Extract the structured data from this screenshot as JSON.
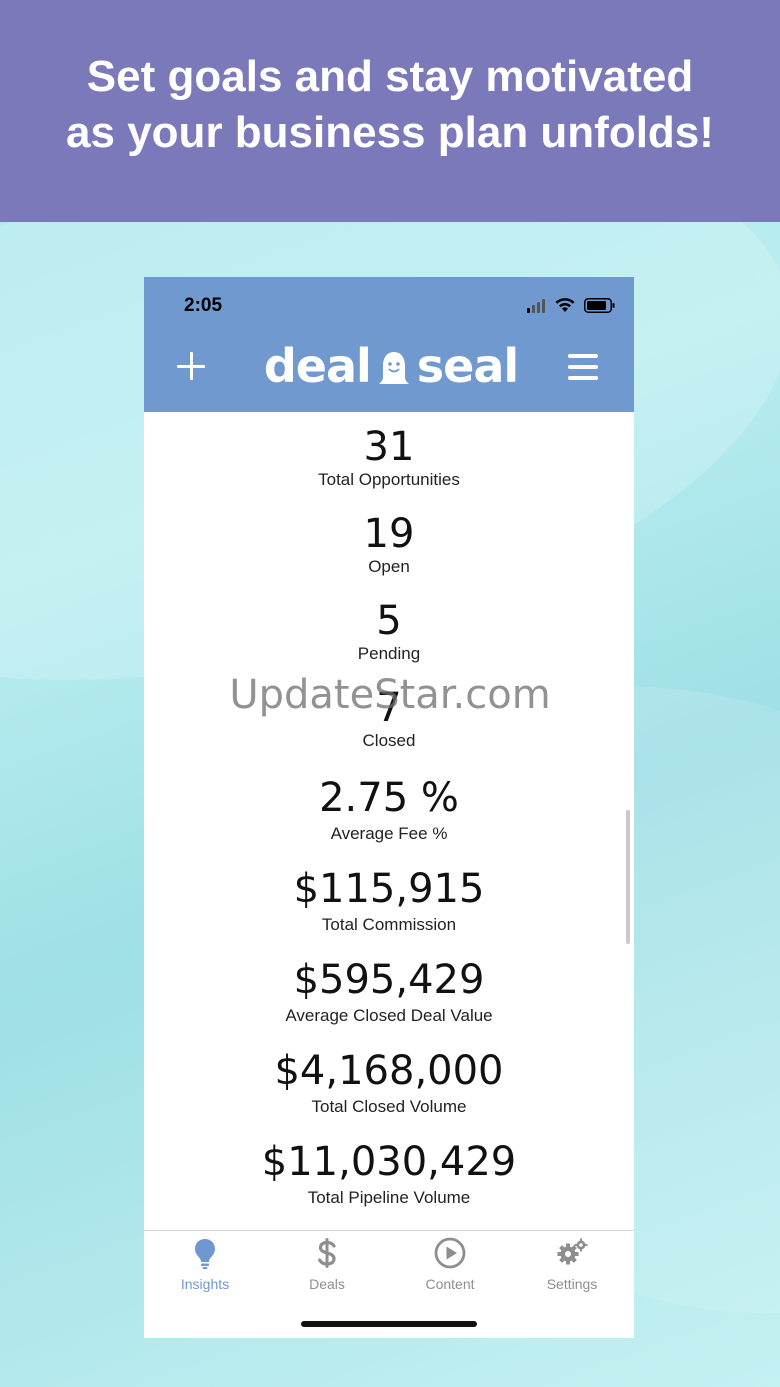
{
  "banner": {
    "line1": "Set goals and stay motivated",
    "line2": "as your business plan unfolds!"
  },
  "status_bar": {
    "time": "2:05"
  },
  "header": {
    "logo_left": "deal",
    "logo_right": "seal",
    "accent_color": "#7099d0"
  },
  "stats": [
    {
      "value": "31",
      "label": "Total Opportunities"
    },
    {
      "value": "19",
      "label": "Open"
    },
    {
      "value": "5",
      "label": "Pending"
    },
    {
      "value": "7",
      "label": "Closed"
    },
    {
      "value": "2.75 %",
      "label": "Average Fee %"
    },
    {
      "value": "$115,915",
      "label": "Total Commission"
    },
    {
      "value": "$595,429",
      "label": "Average Closed Deal Value"
    },
    {
      "value": "$4,168,000",
      "label": "Total Closed Volume"
    },
    {
      "value": "$11,030,429",
      "label": "Total Pipeline Volume"
    }
  ],
  "watermark": "UpdateStar.com",
  "tabs": [
    {
      "label": "Insights",
      "icon": "lightbulb-icon",
      "active": true
    },
    {
      "label": "Deals",
      "icon": "dollar-icon",
      "active": false
    },
    {
      "label": "Content",
      "icon": "play-circle-icon",
      "active": false
    },
    {
      "label": "Settings",
      "icon": "gears-icon",
      "active": false
    }
  ],
  "colors": {
    "banner": "#7c79bb",
    "tab_active": "#6f98d1",
    "tab_inactive": "#8e8e8e"
  }
}
